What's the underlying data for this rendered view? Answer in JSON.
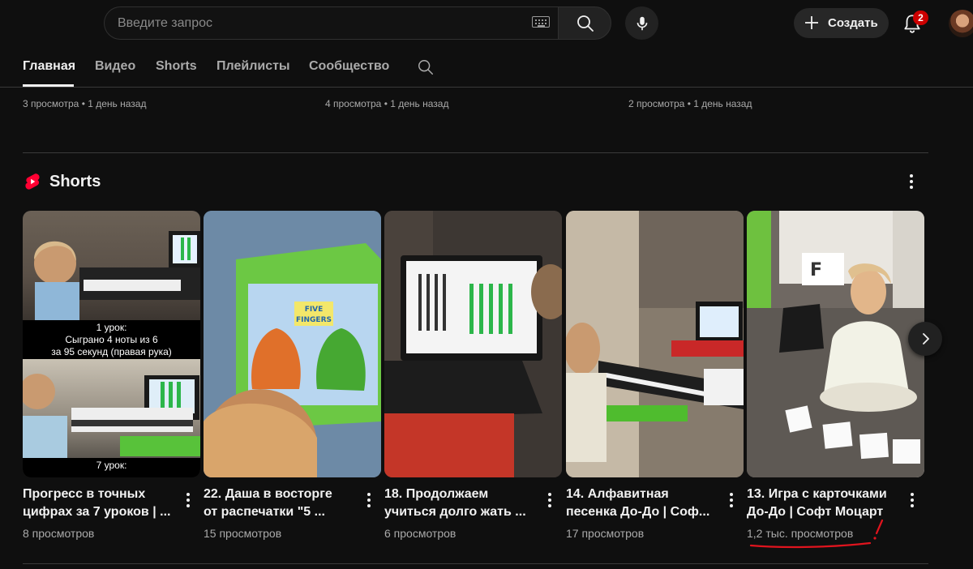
{
  "search": {
    "placeholder": "Введите запрос"
  },
  "header": {
    "create_label": "Создать",
    "notification_count": "2"
  },
  "tabs": [
    {
      "label": "Главная",
      "active": true
    },
    {
      "label": "Видео"
    },
    {
      "label": "Shorts"
    },
    {
      "label": "Плейлисты"
    },
    {
      "label": "Сообщество"
    }
  ],
  "previous_row": [
    {
      "meta": "3 просмотра • 1 день назад"
    },
    {
      "meta": "4 просмотра • 1 день назад"
    },
    {
      "meta": "2 просмотра • 1 день назад"
    }
  ],
  "shorts": {
    "title": "Shorts",
    "items": [
      {
        "title_line1": "Прогресс в точных",
        "title_line2": "цифрах за 7 уроков | ...",
        "views": "8 просмотров",
        "thumb_caption": [
          "1 урок:",
          "Сыграно 4 ноты из 6",
          "за 95 секунд (правая рука)"
        ],
        "thumb_caption2": "7 урок:"
      },
      {
        "title_line1": "22. Даша в восторге",
        "title_line2": "от распечатки \"5 ...",
        "views": "15 просмотров",
        "thumb_text_line1": "FIVE",
        "thumb_text_line2": "FINGERS"
      },
      {
        "title_line1": "18. Продолжаем",
        "title_line2": "учиться долго жать ...",
        "views": "6 просмотров"
      },
      {
        "title_line1": "14. Алфавитная",
        "title_line2": "песенка До-До | Соф...",
        "views": "17 просмотров"
      },
      {
        "title_line1": "13. Игра с карточками",
        "title_line2": "До-До | Софт Моцарт",
        "views": "1,2 тыс. просмотров",
        "thumb_letter": "F",
        "highlighted": true
      }
    ]
  },
  "colors": {
    "background": "#0f0f0f",
    "accent_red": "#ff0033",
    "annotation_red": "#e0141e",
    "muted_text": "#aaaaaa"
  }
}
